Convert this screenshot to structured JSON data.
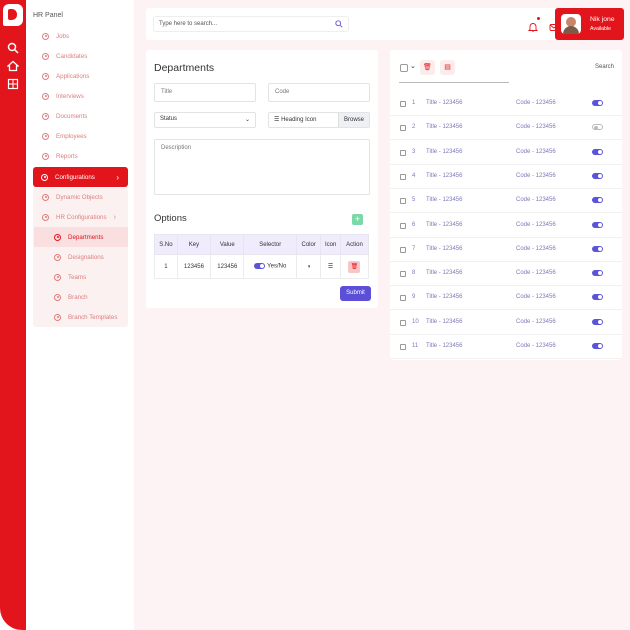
{
  "sidebar": {
    "title": "HR Panel",
    "items": [
      {
        "label": "Jobs"
      },
      {
        "label": "Candidates"
      },
      {
        "label": "Applications"
      },
      {
        "label": "Interviews"
      },
      {
        "label": "Documents"
      },
      {
        "label": "Employees"
      },
      {
        "label": "Reports"
      },
      {
        "label": "Configurations"
      },
      {
        "label": "Dynamic Objects"
      },
      {
        "label": "HR Configurations"
      },
      {
        "label": "Departments"
      },
      {
        "label": "Designations"
      },
      {
        "label": "Teams"
      },
      {
        "label": "Branch"
      },
      {
        "label": "Branch Templates"
      }
    ]
  },
  "topbar": {
    "search_placeholder": "Type here to search...",
    "user_name": "Nik jone",
    "user_status": "Available"
  },
  "form": {
    "title": "Departments",
    "title_placeholder": "Title",
    "code_placeholder": "Code",
    "status_label": "Status",
    "file_label": "Heading Icon",
    "browse_label": "Browse",
    "description_placeholder": "Description",
    "options_title": "Options",
    "add_label": "+",
    "table": {
      "headers": [
        "S.No",
        "Key",
        "Value",
        "Selector",
        "Color",
        "Icon",
        "Action"
      ],
      "row": {
        "sno": "1",
        "key": "123456",
        "value": "123456",
        "selector": "Yes/No"
      }
    },
    "submit_label": "Submit"
  },
  "list": {
    "search_label": "Search",
    "rows": [
      {
        "num": "1",
        "title": "Title - 123456",
        "code": "Code - 123456",
        "enabled": true
      },
      {
        "num": "2",
        "title": "Title - 123456",
        "code": "Code - 123456",
        "enabled": false
      },
      {
        "num": "3",
        "title": "Title - 123456",
        "code": "Code - 123456",
        "enabled": true
      },
      {
        "num": "4",
        "title": "Title - 123456",
        "code": "Code - 123456",
        "enabled": true
      },
      {
        "num": "5",
        "title": "Title - 123456",
        "code": "Code - 123456",
        "enabled": true
      },
      {
        "num": "6",
        "title": "Title - 123456",
        "code": "Code - 123456",
        "enabled": true
      },
      {
        "num": "7",
        "title": "Title - 123456",
        "code": "Code - 123456",
        "enabled": true
      },
      {
        "num": "8",
        "title": "Title - 123456",
        "code": "Code - 123456",
        "enabled": true
      },
      {
        "num": "9",
        "title": "Title - 123456",
        "code": "Code - 123456",
        "enabled": true
      },
      {
        "num": "10",
        "title": "Title - 123456",
        "code": "Code - 123456",
        "enabled": true
      },
      {
        "num": "11",
        "title": "Title - 123456",
        "code": "Code - 123456",
        "enabled": true
      }
    ]
  },
  "colors": {
    "accent": "#e3151c",
    "primary": "#5a4fd6",
    "success": "#7bd8a8"
  }
}
